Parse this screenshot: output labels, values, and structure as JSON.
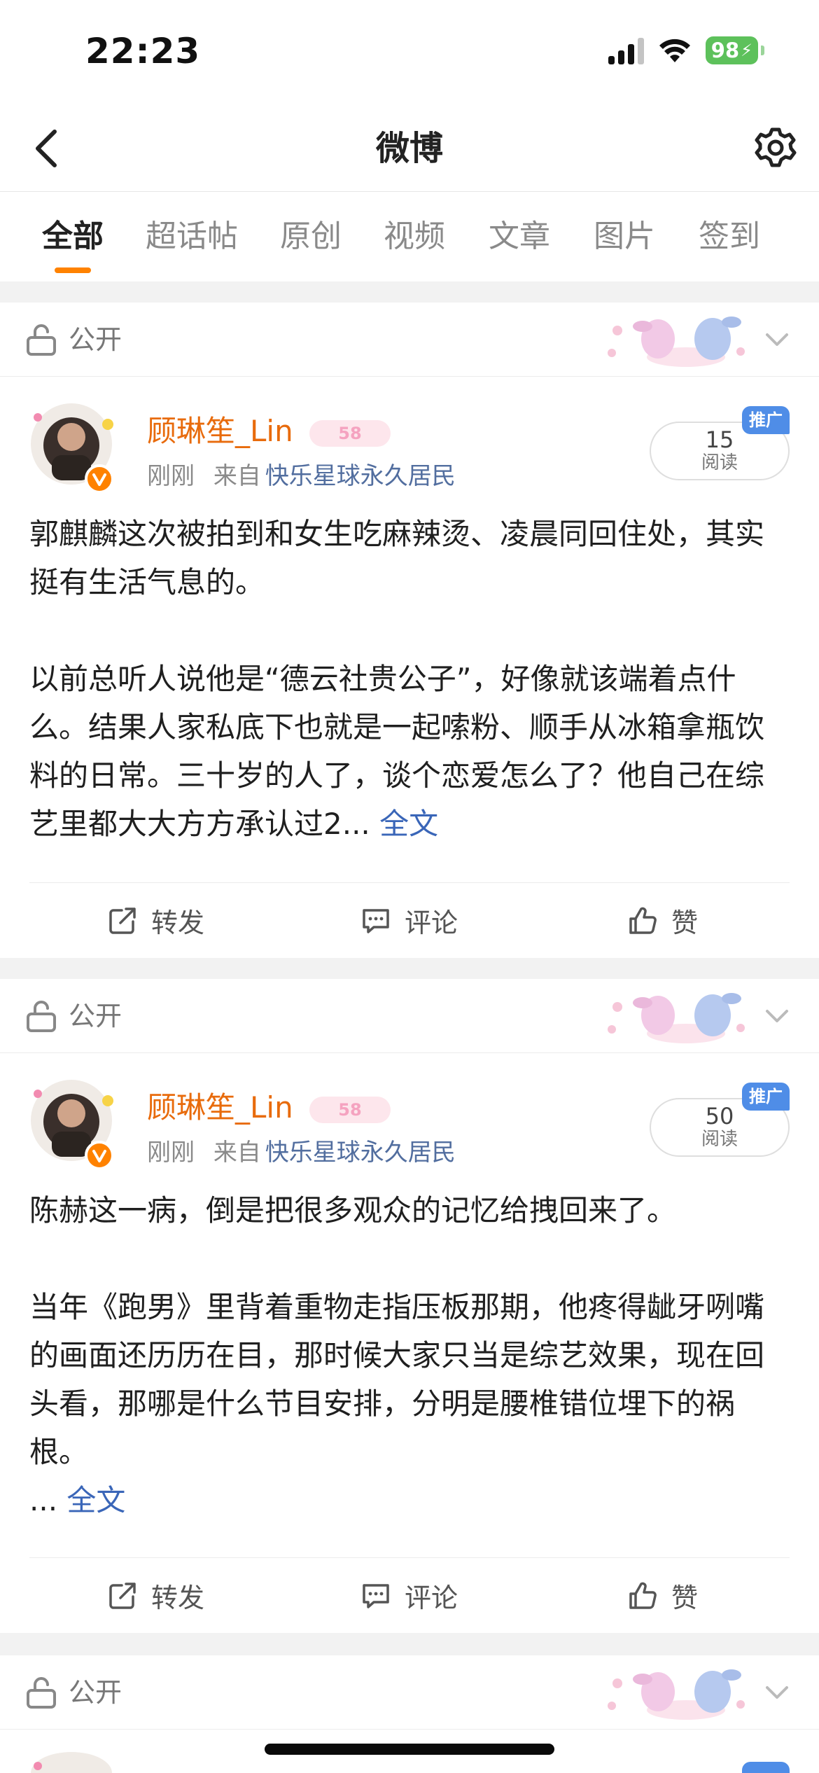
{
  "status_bar": {
    "time": "22:23",
    "battery": "98"
  },
  "nav": {
    "title": "微博"
  },
  "tabs": [
    {
      "label": "全部"
    },
    {
      "label": "超话帖"
    },
    {
      "label": "原创"
    },
    {
      "label": "视频"
    },
    {
      "label": "文章"
    },
    {
      "label": "图片"
    },
    {
      "label": "签到"
    }
  ],
  "posts": [
    {
      "visibility": "公开",
      "username": "顾琳笙_Lin",
      "user_badge": "58",
      "time": "刚刚",
      "source_prefix": "来自",
      "source": "快乐星球永久居民",
      "read_count": "15",
      "read_label": "阅读",
      "promo_badge": "推广",
      "paragraphs": [
        "郭麒麟这次被拍到和女生吃麻辣烫、凌晨同回住处，其实挺有生活气息的。",
        "以前总听人说他是“德云社贵公子”，好像就该端着点什么。结果人家私底下也就是一起嗦粉、顺手从冰箱拿瓶饮料的日常。三十岁的人了，谈个恋爱怎么了？他自己在综艺里都大大方方承认过2..."
      ],
      "full_link": "全文",
      "actions": {
        "repost": "转发",
        "comment": "评论",
        "like": "赞"
      }
    },
    {
      "visibility": "公开",
      "username": "顾琳笙_Lin",
      "user_badge": "58",
      "time": "刚刚",
      "source_prefix": "来自",
      "source": "快乐星球永久居民",
      "read_count": "50",
      "read_label": "阅读",
      "promo_badge": "推广",
      "paragraphs": [
        "陈赫这一病，倒是把很多观众的记忆给拽回来了。",
        "当年《跑男》里背着重物走指压板那期，他疼得龇牙咧嘴的画面还历历在目，那时候大家只当是综艺效果，现在回头看，那哪是什么节目安排，分明是腰椎错位埋下的祸根。"
      ],
      "ellipsis": "...",
      "full_link": "全文",
      "actions": {
        "repost": "转发",
        "comment": "评论",
        "like": "赞"
      }
    },
    {
      "visibility": "公开"
    }
  ]
}
